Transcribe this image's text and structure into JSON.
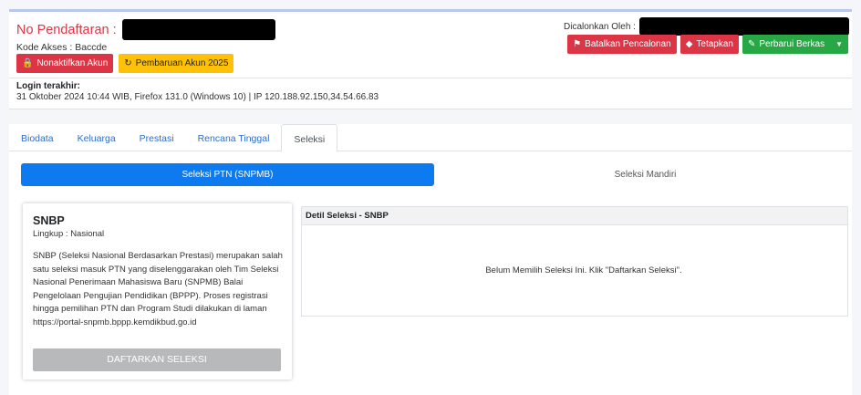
{
  "header": {
    "reg_label": "No Pendaftaran :",
    "access_code": "Kode Akses : Baccde",
    "buttons_left": [
      {
        "icon": "lock-icon",
        "glyph": "🔒",
        "label": "Nonaktifkan Akun"
      },
      {
        "icon": "sync-icon",
        "glyph": "↻",
        "label": "Pembaruan Akun 2025"
      }
    ],
    "candidate_label": "Dicalonkan Oleh :",
    "buttons_right": [
      {
        "icon": "flag-icon",
        "glyph": "⚑",
        "label": "Batalkan Pencalonan"
      },
      {
        "icon": "tag-icon",
        "glyph": "◆",
        "label": "Tetapkan"
      },
      {
        "icon": "pencil-icon",
        "glyph": "✎",
        "label": "Perbarui Berkas"
      }
    ],
    "login_title": "Login terakhir:",
    "login_info": "31 Oktober 2024 10:44 WIB, Firefox 131.0 (Windows 10) | IP 120.188.92.150,34.54.66.83"
  },
  "tabs": [
    "Biodata",
    "Keluarga",
    "Prestasi",
    "Rencana Tinggal",
    "Seleksi"
  ],
  "active_tab": "Seleksi",
  "selection_tabs": {
    "active": "Seleksi PTN (SNPMB)",
    "inactive": "Seleksi Mandiri"
  },
  "snbp": {
    "title": "SNBP",
    "scope": "Lingkup : Nasional",
    "description": "SNBP (Seleksi Nasional Berdasarkan Prestasi) merupakan salah satu seleksi masuk PTN yang diselenggarakan oleh Tim Seleksi Nasional Penerimaan Mahasiswa Baru (SNPMB) Balai Pengelolaan Pengujian Pendidikan (BPPP). Proses registrasi hingga pemilihan PTN dan Program Studi dilakukan di laman https://portal-snpmb.bppp.kemdikbud.go.id",
    "button": "DAFTARKAN SELEKSI"
  },
  "detail": {
    "title": "Detil Seleksi - SNBP",
    "message": "Belum Memilih Seleksi Ini. Klik \"Daftarkan Seleksi\"."
  },
  "colors": {
    "danger": "#dc3545",
    "warning": "#ffc107",
    "success": "#28a745",
    "primary": "#0d7af0",
    "disabled": "#b7b9bb"
  }
}
